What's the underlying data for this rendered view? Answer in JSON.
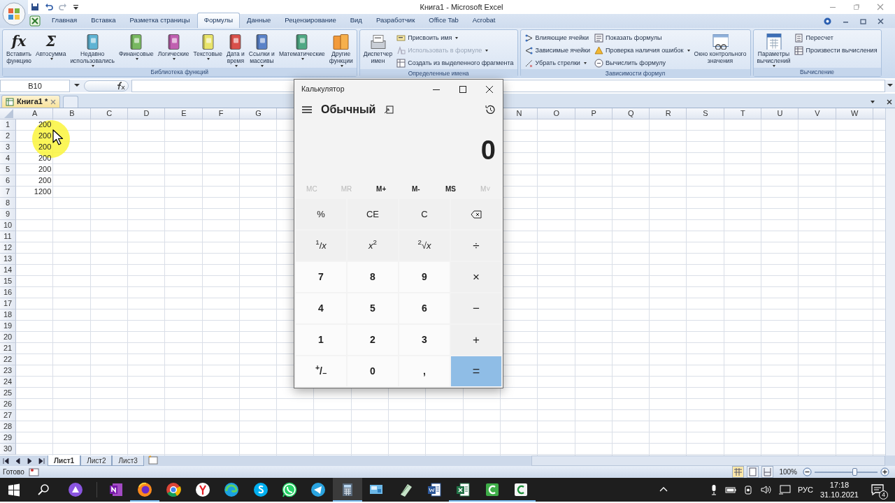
{
  "title_bar": {
    "title": "Книга1 - Microsoft Excel"
  },
  "ribbon": {
    "tabs": [
      {
        "label": "Главная",
        "selected": false
      },
      {
        "label": "Вставка",
        "selected": false
      },
      {
        "label": "Разметка страницы",
        "selected": false
      },
      {
        "label": "Формулы",
        "selected": true
      },
      {
        "label": "Данные",
        "selected": false
      },
      {
        "label": "Рецензирование",
        "selected": false
      },
      {
        "label": "Вид",
        "selected": false
      },
      {
        "label": "Разработчик",
        "selected": false
      },
      {
        "label": "Office Tab",
        "selected": false
      },
      {
        "label": "Acrobat",
        "selected": false
      }
    ],
    "groups": [
      {
        "label": "Библиотека функций",
        "items": [
          {
            "kind": "large",
            "glyph": "fx",
            "lines": [
              "Вставить",
              "функцию"
            ],
            "dropdown": false
          },
          {
            "kind": "large",
            "glyph": "Σ",
            "lines": [
              "Автосумма"
            ],
            "dropdown": true
          },
          {
            "kind": "large",
            "lines": [
              "Недавно",
              "использовались"
            ],
            "dropdown": true
          },
          {
            "kind": "large",
            "lines": [
              "Финансовые"
            ],
            "dropdown": true
          },
          {
            "kind": "large",
            "lines": [
              "Логические"
            ],
            "dropdown": true
          },
          {
            "kind": "large",
            "lines": [
              "Текстовые"
            ],
            "dropdown": true
          },
          {
            "kind": "large",
            "lines": [
              "Дата и",
              "время"
            ],
            "dropdown": true
          },
          {
            "kind": "large",
            "lines": [
              "Ссылки и",
              "массивы"
            ],
            "dropdown": true
          },
          {
            "kind": "large",
            "lines": [
              "Математические"
            ],
            "dropdown": true
          },
          {
            "kind": "large",
            "lines": [
              "Другие",
              "функции"
            ],
            "dropdown": true
          }
        ]
      },
      {
        "label": "Определенные имена",
        "items": [
          {
            "kind": "large",
            "lines": [
              "Диспетчер",
              "имен"
            ],
            "dropdown": false
          },
          {
            "kind": "stack",
            "entries": [
              {
                "label": "Присвоить имя",
                "dropdown": true,
                "disabled": false
              },
              {
                "label": "Использовать в формуле",
                "dropdown": true,
                "disabled": true
              },
              {
                "label": "Создать из выделенного фрагмента",
                "dropdown": false,
                "disabled": false
              }
            ]
          }
        ]
      },
      {
        "label": "Зависимости формул",
        "items": [
          {
            "kind": "stack",
            "entries": [
              {
                "label": "Влияющие ячейки",
                "dropdown": false,
                "disabled": false
              },
              {
                "label": "Зависимые ячейки",
                "dropdown": false,
                "disabled": false
              },
              {
                "label": "Убрать стрелки",
                "dropdown": true,
                "disabled": false
              }
            ]
          },
          {
            "kind": "stack",
            "entries": [
              {
                "label": "Показать формулы",
                "dropdown": false,
                "disabled": false
              },
              {
                "label": "Проверка наличия ошибок",
                "dropdown": true,
                "disabled": false
              },
              {
                "label": "Вычислить формулу",
                "dropdown": false,
                "disabled": false
              }
            ]
          },
          {
            "kind": "large",
            "lines": [
              "Окно контрольного",
              "значения"
            ],
            "dropdown": false
          }
        ]
      },
      {
        "label": "Вычисление",
        "items": [
          {
            "kind": "large",
            "lines": [
              "Параметры",
              "вычислений"
            ],
            "dropdown": true
          },
          {
            "kind": "stack",
            "entries": [
              {
                "label": "Пересчет",
                "dropdown": false,
                "disabled": false
              },
              {
                "label": "Произвести вычисления",
                "dropdown": false,
                "disabled": false
              }
            ]
          }
        ]
      }
    ]
  },
  "formula_bar": {
    "name_box": "B10"
  },
  "workbook_tabs": [
    {
      "label": "Книга1 *",
      "selected": true
    }
  ],
  "sheet": {
    "columns_left": [
      "A",
      "B",
      "C",
      "D",
      "E",
      "F",
      "G"
    ],
    "columns_right": [
      "N",
      "O",
      "P",
      "Q",
      "R",
      "S",
      "T",
      "U",
      "V",
      "W"
    ],
    "rows": [
      {
        "number": "1",
        "a": "200"
      },
      {
        "number": "2",
        "a": "200"
      },
      {
        "number": "3",
        "a": "200"
      },
      {
        "number": "4",
        "a": "200"
      },
      {
        "number": "5",
        "a": "200"
      },
      {
        "number": "6",
        "a": "200"
      },
      {
        "number": "7",
        "a": "1200"
      },
      {
        "number": "8"
      },
      {
        "number": "9"
      },
      {
        "number": "10"
      },
      {
        "number": "11"
      },
      {
        "number": "12"
      },
      {
        "number": "13"
      },
      {
        "number": "14"
      },
      {
        "number": "15"
      },
      {
        "number": "16"
      },
      {
        "number": "17"
      },
      {
        "number": "18"
      },
      {
        "number": "19"
      },
      {
        "number": "20"
      },
      {
        "number": "21"
      },
      {
        "number": "22"
      },
      {
        "number": "23"
      },
      {
        "number": "24"
      },
      {
        "number": "25"
      },
      {
        "number": "26"
      },
      {
        "number": "27"
      },
      {
        "number": "28"
      },
      {
        "number": "29"
      },
      {
        "number": "30"
      }
    ]
  },
  "calculator": {
    "title": "Калькулятор",
    "mode": "Обычный",
    "display": "0",
    "memory": [
      {
        "label": "MC",
        "disabled": true
      },
      {
        "label": "MR",
        "disabled": true
      },
      {
        "label": "M+",
        "disabled": false
      },
      {
        "label": "M-",
        "disabled": false
      },
      {
        "label": "MS",
        "disabled": false
      },
      {
        "label": "M˅",
        "disabled": true
      }
    ],
    "keys": [
      {
        "label": "%",
        "kind": "function"
      },
      {
        "label": "CE",
        "kind": "function"
      },
      {
        "label": "C",
        "kind": "function"
      },
      {
        "kind": "backspace"
      },
      {
        "label": "$^{1}$/*x*",
        "kind": "function"
      },
      {
        "label": "*x*$^{2}$",
        "kind": "function"
      },
      {
        "label": "$^{2}$√*x*",
        "kind": "function"
      },
      {
        "label": "÷",
        "kind": "operator"
      },
      {
        "label": "7",
        "kind": "digit"
      },
      {
        "label": "8",
        "kind": "digit"
      },
      {
        "label": "9",
        "kind": "digit"
      },
      {
        "label": "×",
        "kind": "operator"
      },
      {
        "label": "4",
        "kind": "digit"
      },
      {
        "label": "5",
        "kind": "digit"
      },
      {
        "label": "6",
        "kind": "digit"
      },
      {
        "label": "−",
        "kind": "operator"
      },
      {
        "label": "1",
        "kind": "digit"
      },
      {
        "label": "2",
        "kind": "digit"
      },
      {
        "label": "3",
        "kind": "digit"
      },
      {
        "label": "+",
        "kind": "operator"
      },
      {
        "label": "$^{+}$/$_{−}$",
        "kind": "digit"
      },
      {
        "label": "0",
        "kind": "digit"
      },
      {
        "label": ",",
        "kind": "digit"
      },
      {
        "label": "=",
        "kind": "equals"
      }
    ]
  },
  "sheet_tabs": [
    {
      "label": "Лист1",
      "selected": true
    },
    {
      "label": "Лист2",
      "selected": false
    },
    {
      "label": "Лист3",
      "selected": false
    }
  ],
  "status_bar": {
    "status": "Готово",
    "zoom": "100%",
    "zoom_slider": {
      "level": 0.63
    }
  },
  "taskbar": {
    "apps": [
      {
        "running": false,
        "active": false
      },
      {
        "running": true,
        "active": false
      },
      {
        "running": false,
        "active": false
      },
      {
        "running": false,
        "active": false
      },
      {
        "running": false,
        "active": false
      },
      {
        "running": false,
        "active": false
      },
      {
        "running": false,
        "active": false
      },
      {
        "running": false,
        "active": false
      },
      {
        "running": true,
        "active": true
      },
      {
        "running": false,
        "active": false
      },
      {
        "running": false,
        "active": false
      },
      {
        "running": false,
        "active": false
      },
      {
        "running": true,
        "active": false
      },
      {
        "running": true,
        "active": false
      },
      {
        "running": true,
        "active": false
      }
    ],
    "language": "РУС",
    "time": "17:18",
    "date": "31.10.2021",
    "notifications": "4"
  }
}
